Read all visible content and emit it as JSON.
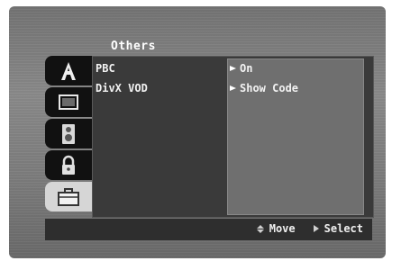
{
  "menu": {
    "title": "Others",
    "items": [
      {
        "label": "PBC",
        "value": "On"
      },
      {
        "label": "DivX VOD",
        "value": "Show Code"
      }
    ]
  },
  "tabs": [
    {
      "icon": "language-a-icon",
      "selected": false
    },
    {
      "icon": "display-tv-icon",
      "selected": false
    },
    {
      "icon": "speaker-audio-icon",
      "selected": false
    },
    {
      "icon": "padlock-icon",
      "selected": false
    },
    {
      "icon": "briefcase-icon",
      "selected": true
    }
  ],
  "footer": {
    "move_label": "Move",
    "select_label": "Select"
  },
  "colors": {
    "background": "#7c7c7c",
    "panel": "#3a3a3a",
    "active_tab": "#d6d6d6"
  }
}
